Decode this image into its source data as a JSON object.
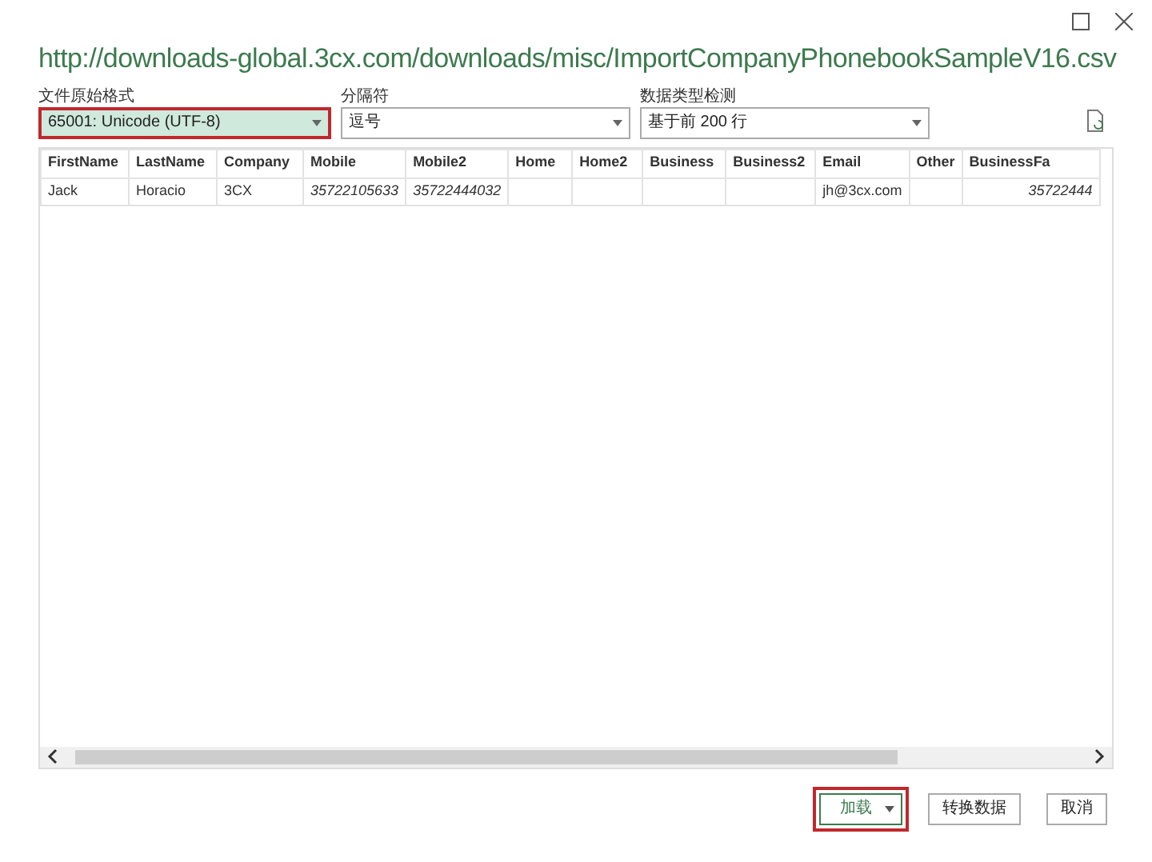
{
  "window": {
    "title": "http://downloads-global.3cx.com/downloads/misc/ImportCompanyPhonebookSampleV16.csv"
  },
  "options": [
    {
      "label": "文件原始格式",
      "value": "65001: Unicode (UTF-8)",
      "highlighted": true
    },
    {
      "label": "分隔符",
      "value": "逗号",
      "highlighted": false
    },
    {
      "label": "数据类型检测",
      "value": "基于前 200 行",
      "highlighted": false
    }
  ],
  "table": {
    "columns": [
      "FirstName",
      "LastName",
      "Company",
      "Mobile",
      "Mobile2",
      "Home",
      "Home2",
      "Business",
      "Business2",
      "Email",
      "Other",
      "BusinessFa"
    ],
    "rows": [
      [
        "Jack",
        "Horacio",
        "3CX",
        "35722105633",
        "35722444032",
        "",
        "",
        "",
        "",
        "jh@3cx.com",
        "",
        "35722444"
      ]
    ]
  },
  "buttons": [
    {
      "kind": "split",
      "label": "加载",
      "highlighted": true
    },
    {
      "kind": "plain",
      "label": "转换数据",
      "highlighted": false
    },
    {
      "kind": "plain",
      "label": "取消",
      "highlighted": false
    }
  ]
}
